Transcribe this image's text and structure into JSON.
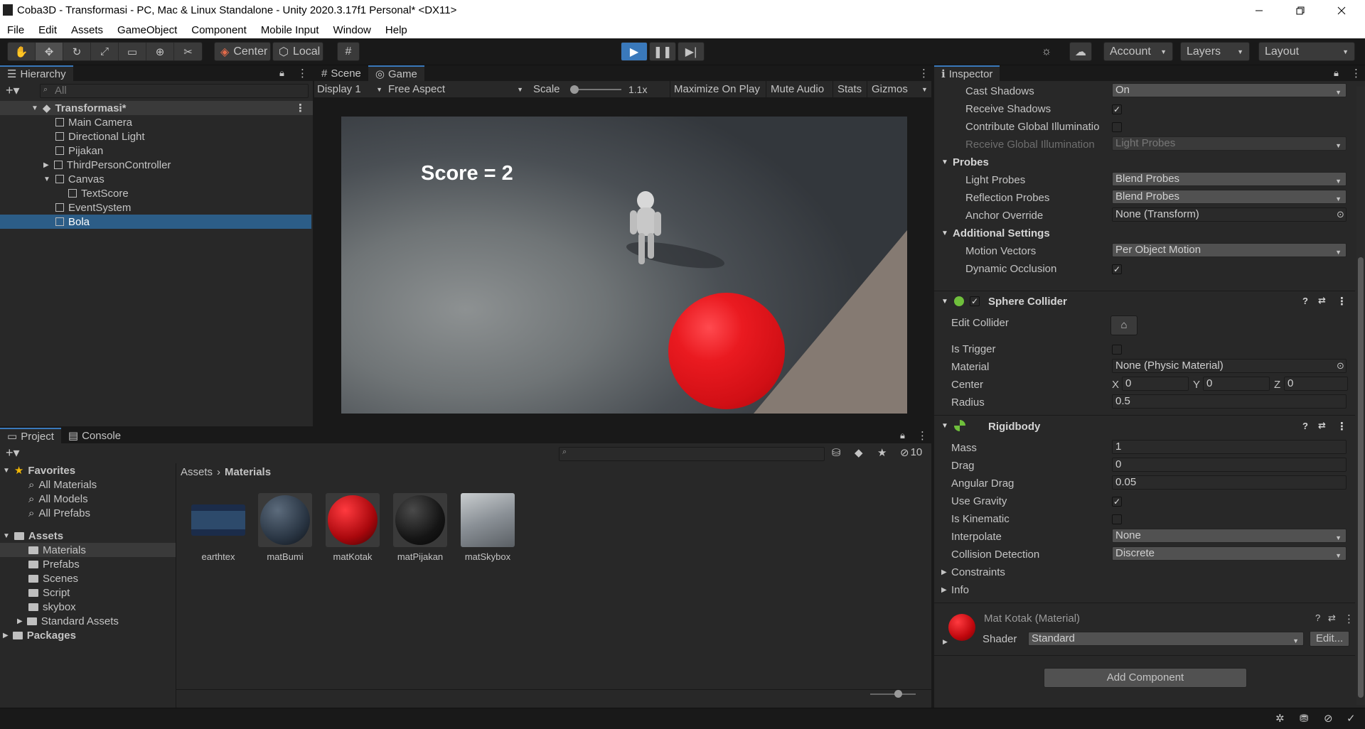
{
  "window": {
    "title": "Coba3D - Transformasi - PC, Mac & Linux Standalone - Unity 2020.3.17f1 Personal* <DX11>"
  },
  "menu": [
    "File",
    "Edit",
    "Assets",
    "GameObject",
    "Component",
    "Mobile Input",
    "Window",
    "Help"
  ],
  "toolbar": {
    "pivot": "Center",
    "space": "Local",
    "account": "Account",
    "layers": "Layers",
    "layout": "Layout"
  },
  "hierarchy": {
    "tab": "Hierarchy",
    "search_placeholder": "All",
    "scene": "Transformasi*",
    "items": [
      "Main Camera",
      "Directional Light",
      "Pijakan",
      "ThirdPersonController",
      "Canvas",
      "TextScore",
      "EventSystem",
      "Bola"
    ]
  },
  "game": {
    "tab_scene": "Scene",
    "tab_game": "Game",
    "display": "Display 1",
    "aspect": "Free Aspect",
    "scale_label": "Scale",
    "scale_value": "1.1x",
    "maximize": "Maximize On Play",
    "mute": "Mute Audio",
    "stats": "Stats",
    "gizmos": "Gizmos",
    "score_text": "Score = 2"
  },
  "inspector": {
    "tab": "Inspector",
    "lighting": {
      "cast_shadows": "Cast Shadows",
      "cast_shadows_val": "On",
      "receive_shadows": "Receive Shadows",
      "contribute_gi": "Contribute Global Illuminatio",
      "receive_gi": "Receive Global Illumination",
      "receive_gi_val": "Light Probes"
    },
    "probes": {
      "header": "Probes",
      "light_probes": "Light Probes",
      "light_probes_val": "Blend Probes",
      "reflection_probes": "Reflection Probes",
      "reflection_probes_val": "Blend Probes",
      "anchor_override": "Anchor Override",
      "anchor_override_val": "None (Transform)"
    },
    "additional": {
      "header": "Additional Settings",
      "motion_vectors": "Motion Vectors",
      "motion_vectors_val": "Per Object Motion",
      "dynamic_occlusion": "Dynamic Occlusion"
    },
    "sphere": {
      "header": "Sphere Collider",
      "edit_collider": "Edit Collider",
      "is_trigger": "Is Trigger",
      "material": "Material",
      "material_val": "None (Physic Material)",
      "center": "Center",
      "x": "X",
      "y": "Y",
      "z": "Z",
      "cx": "0",
      "cy": "0",
      "cz": "0",
      "radius": "Radius",
      "radius_val": "0.5"
    },
    "rigidbody": {
      "header": "Rigidbody",
      "mass": "Mass",
      "mass_val": "1",
      "drag": "Drag",
      "drag_val": "0",
      "angular_drag": "Angular Drag",
      "angular_drag_val": "0.05",
      "use_gravity": "Use Gravity",
      "is_kinematic": "Is Kinematic",
      "interpolate": "Interpolate",
      "interpolate_val": "None",
      "collision_detection": "Collision Detection",
      "collision_detection_val": "Discrete",
      "constraints": "Constraints",
      "info": "Info"
    },
    "material": {
      "name": "Mat Kotak (Material)",
      "shader_label": "Shader",
      "shader_val": "Standard",
      "edit": "Edit..."
    },
    "add_component": "Add Component"
  },
  "project": {
    "tab_project": "Project",
    "tab_console": "Console",
    "hidden_count": "10",
    "favorites": "Favorites",
    "fav_items": [
      "All Materials",
      "All Models",
      "All Prefabs"
    ],
    "assets": "Assets",
    "folders": [
      "Materials",
      "Prefabs",
      "Scenes",
      "Script",
      "skybox",
      "Standard Assets"
    ],
    "packages": "Packages",
    "breadcrumb": [
      "Assets",
      "Materials"
    ],
    "asset_items": [
      "earthtex",
      "matBumi",
      "matKotak",
      "matPijakan",
      "matSkybox"
    ]
  },
  "colors": {
    "accent": "#3a79bb",
    "selection": "#2c5d87",
    "ball": "#e8141c"
  }
}
